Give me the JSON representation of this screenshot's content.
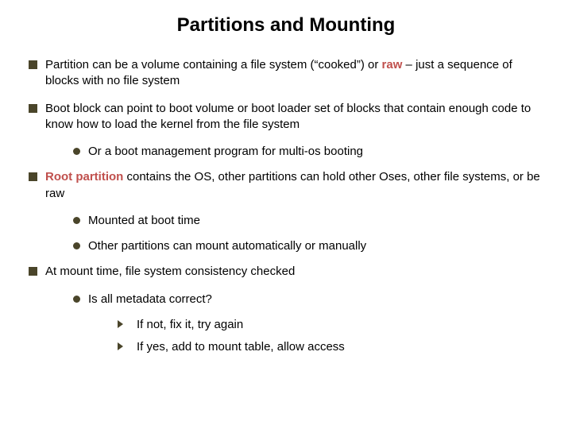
{
  "title": "Partitions and Mounting",
  "b1": {
    "pre": "Partition can be a volume containing a file system (“cooked”) or ",
    "em": "raw",
    "post": " – just a sequence of blocks with no file system"
  },
  "b2": "Boot block can point to boot volume or boot loader set of blocks that contain enough code to know how to load the kernel from the file system",
  "b2a": "Or a boot management program for multi-os booting",
  "b3": {
    "em": "Root partition",
    "post": " contains the OS, other partitions can hold other Oses, other file systems, or be raw"
  },
  "b3a": "Mounted at boot time",
  "b3b": "Other partitions can mount automatically or manually",
  "b4": "At mount time, file system consistency checked",
  "b4a": "Is all metadata correct?",
  "b4a1": "If not, fix it, try again",
  "b4a2": "If yes, add to mount table, allow access"
}
